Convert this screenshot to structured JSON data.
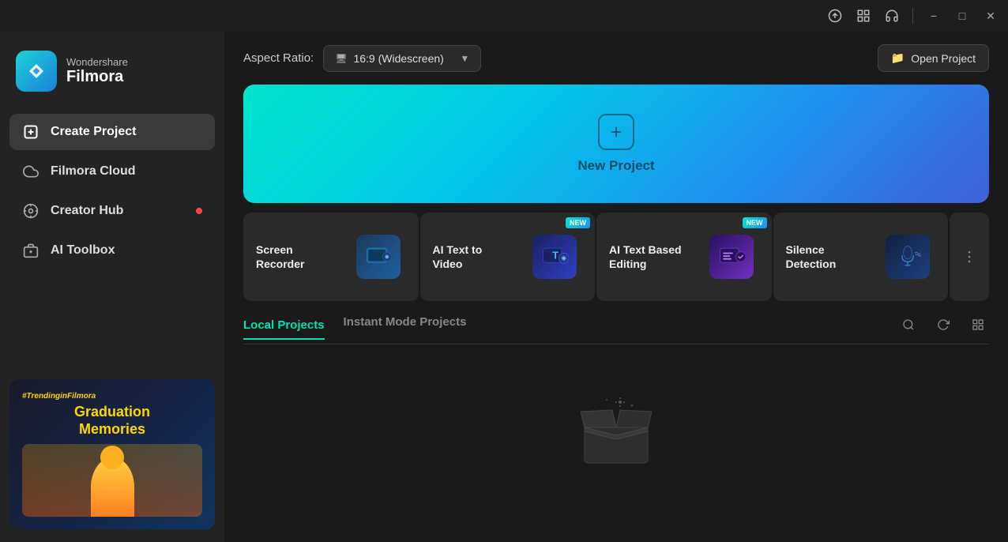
{
  "titlebar": {
    "upload_icon": "⬆",
    "grid_icon": "⊞",
    "headset_icon": "🎧",
    "minimize_label": "−",
    "maximize_label": "□",
    "close_label": "✕"
  },
  "sidebar": {
    "brand": "Wondershare",
    "product": "Filmora",
    "nav": [
      {
        "id": "create-project",
        "label": "Create Project",
        "icon": "➕",
        "active": true,
        "dot": false
      },
      {
        "id": "filmora-cloud",
        "label": "Filmora Cloud",
        "icon": "☁",
        "active": false,
        "dot": false
      },
      {
        "id": "creator-hub",
        "label": "Creator Hub",
        "icon": "🎯",
        "active": false,
        "dot": true
      },
      {
        "id": "ai-toolbox",
        "label": "AI Toolbox",
        "icon": "🤖",
        "active": false,
        "dot": false
      }
    ],
    "promo": {
      "tag": "#TrendinginFilmora",
      "title": "Graduation\nMemories"
    }
  },
  "header": {
    "aspect_ratio_label": "Aspect Ratio:",
    "aspect_ratio_value": "16:9 (Widescreen)",
    "open_project_label": "Open Project"
  },
  "new_project": {
    "label": "New Project"
  },
  "tool_cards": [
    {
      "id": "screen-recorder",
      "label": "Screen Recorder",
      "new": false,
      "icon": "📹"
    },
    {
      "id": "ai-text-to-video",
      "label": "AI Text to Video",
      "new": true,
      "icon": "🅣"
    },
    {
      "id": "ai-text-based-editing",
      "label": "AI Text Based Editing",
      "new": true,
      "icon": "✏"
    },
    {
      "id": "silence-detection",
      "label": "Silence Detection",
      "new": false,
      "icon": "🎧"
    }
  ],
  "projects": {
    "tabs": [
      {
        "id": "local",
        "label": "Local Projects",
        "active": true
      },
      {
        "id": "instant",
        "label": "Instant Mode Projects",
        "active": false
      }
    ],
    "actions": {
      "search": "🔍",
      "refresh": "↻",
      "layout": "⊞"
    },
    "empty_state": true
  },
  "colors": {
    "accent": "#00e0b0",
    "bg_dark": "#1a1a1a",
    "bg_sidebar": "#232323",
    "bg_card": "#2a2a2a",
    "new_badge_color": "#00e5cc"
  }
}
